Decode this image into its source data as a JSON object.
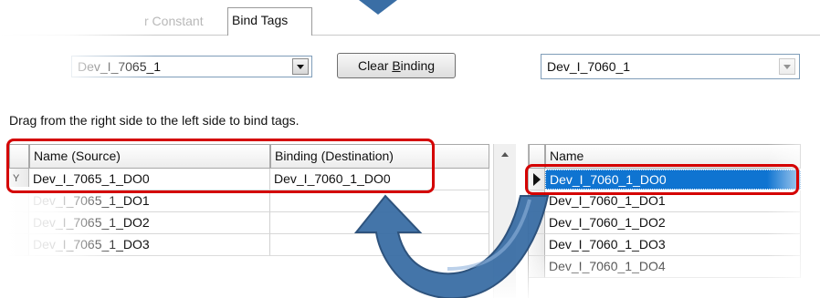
{
  "tabs": {
    "ghost_label": "r Constant",
    "active_label": "Bind Tags"
  },
  "left_combo": {
    "value": "Dev_I_7065_1"
  },
  "clear_button": {
    "label_prefix": "Clear ",
    "label_underlined": "B",
    "label_suffix": "inding"
  },
  "right_combo": {
    "value": "Dev_I_7060_1"
  },
  "hint": "Drag from the right side to the left side to bind tags.",
  "left_grid": {
    "columns": [
      "Name (Source)",
      "Binding (Destination)"
    ],
    "rows": [
      {
        "selector": "Y",
        "name": "Dev_I_7065_1_DO0",
        "binding": "Dev_I_7060_1_DO0"
      },
      {
        "selector": "",
        "name": "Dev_I_7065_1_DO1",
        "binding": ""
      },
      {
        "selector": "",
        "name": "Dev_I_7065_1_DO2",
        "binding": ""
      },
      {
        "selector": "",
        "name": "Dev_I_7065_1_DO3",
        "binding": ""
      }
    ]
  },
  "right_grid": {
    "columns": [
      "Name"
    ],
    "rows": [
      {
        "name": "Dev_I_7060_1_DO0",
        "selected": true
      },
      {
        "name": "Dev_I_7060_1_DO1",
        "selected": false
      },
      {
        "name": "Dev_I_7060_1_DO2",
        "selected": false
      },
      {
        "name": "Dev_I_7060_1_DO3",
        "selected": false
      },
      {
        "name": "Dev_I_7060_1_DO4",
        "selected": false
      }
    ]
  },
  "colors": {
    "highlight": "#d40000",
    "arrow": "#3a6ea5",
    "selection": "#0f74d1"
  }
}
